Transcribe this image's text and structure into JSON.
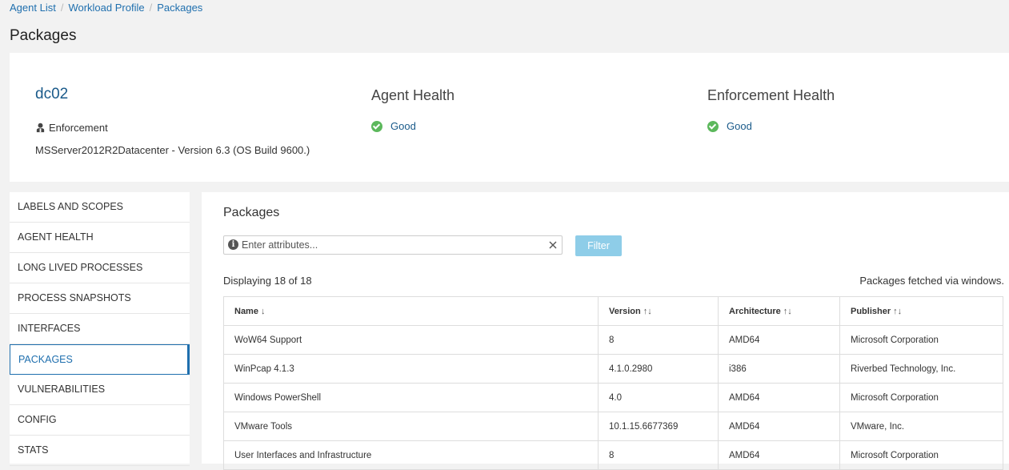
{
  "breadcrumb": [
    "Agent List",
    "Workload Profile",
    "Packages"
  ],
  "page_title": "Packages",
  "summary": {
    "hostname": "dc02",
    "enforcement_label": "Enforcement",
    "os": "MSServer2012R2Datacenter - Version 6.3 (OS Build 9600.)",
    "agent_health": {
      "title": "Agent Health",
      "status": "Good"
    },
    "enforcement_health": {
      "title": "Enforcement Health",
      "status": "Good"
    },
    "status_color": "#5cb85c"
  },
  "nav": {
    "items": [
      "LABELS AND SCOPES",
      "AGENT HEALTH",
      "LONG LIVED PROCESSES",
      "PROCESS SNAPSHOTS",
      "INTERFACES",
      "PACKAGES",
      "VULNERABILITIES",
      "CONFIG",
      "STATS"
    ],
    "active": "PACKAGES"
  },
  "main": {
    "title": "Packages",
    "filter_placeholder": "Enter attributes...",
    "filter_button": "Filter",
    "displaying": "Displaying 18 of 18",
    "fetched_via": "Packages fetched via windows.",
    "columns": [
      {
        "label": "Name",
        "sort": "↓"
      },
      {
        "label": "Version",
        "sort": "↑↓"
      },
      {
        "label": "Architecture",
        "sort": "↑↓"
      },
      {
        "label": "Publisher",
        "sort": "↑↓"
      }
    ],
    "rows": [
      [
        "WoW64 Support",
        "8",
        "AMD64",
        "Microsoft Corporation"
      ],
      [
        "WinPcap 4.1.3",
        "4.1.0.2980",
        "i386",
        "Riverbed Technology, Inc."
      ],
      [
        "Windows PowerShell",
        "4.0",
        "AMD64",
        "Microsoft Corporation"
      ],
      [
        "VMware Tools",
        "10.1.15.6677369",
        "AMD64",
        "VMware, Inc."
      ],
      [
        "User Interfaces and Infrastructure",
        "8",
        "AMD64",
        "Microsoft Corporation"
      ]
    ]
  },
  "colors": {
    "link": "#1f6fae",
    "filter_button": "#8ecde8"
  }
}
